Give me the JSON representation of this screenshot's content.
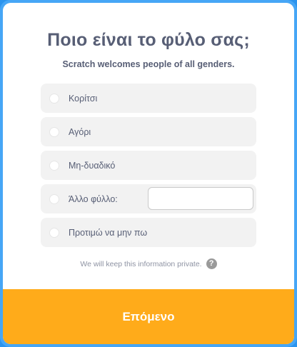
{
  "title": "Ποιο είναι το φύλο σας;",
  "subtitle": "Scratch welcomes people of all genders.",
  "options": [
    {
      "label": "Κορίτσι",
      "selected": false
    },
    {
      "label": "Αγόρι",
      "selected": false
    },
    {
      "label": "Μη-δυαδικό",
      "selected": false
    },
    {
      "label": "Άλλο φύλλο:",
      "selected": false,
      "input_value": ""
    },
    {
      "label": "Προτιμώ να μην πω",
      "selected": false
    }
  ],
  "privacy_text": "We will keep this information private.",
  "help_icon": {
    "name": "question-mark-icon",
    "glyph": "?"
  },
  "next_button": {
    "label": "Επόμενο"
  },
  "colors": {
    "frame": "#46a6f6",
    "button": "#ffab1a",
    "text": "#575e75",
    "option_bg": "#f2f2f2"
  }
}
